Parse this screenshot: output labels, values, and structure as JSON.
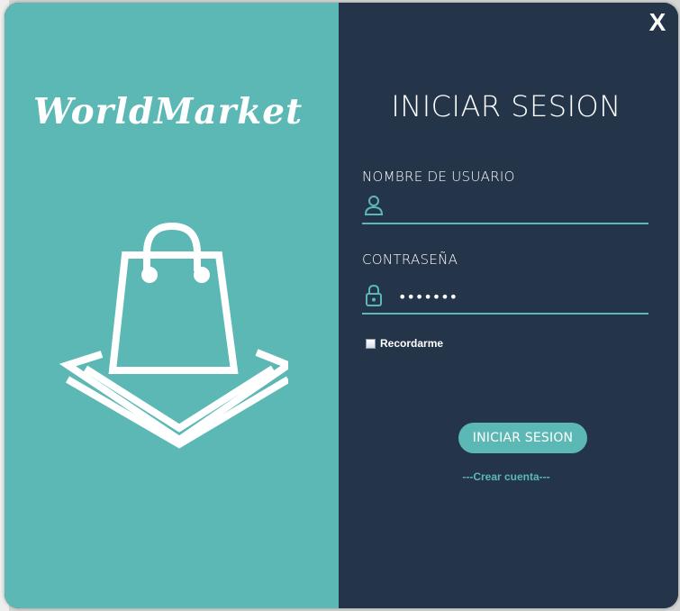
{
  "brand": {
    "name": "WorldMarket",
    "art_icon": "shopping-bag-icon"
  },
  "window": {
    "close_label": "X"
  },
  "login": {
    "title": "INICIAR SESION",
    "username_label": "NOMBRE DE USUARIO",
    "username_value": "",
    "username_icon": "user-icon",
    "password_label": "CONTRASEÑA",
    "password_value": "•••••••",
    "password_icon": "lock-icon",
    "remember_label": "Recordarme",
    "remember_checked": false,
    "submit_label": "INICIAR SESION",
    "create_account_label": "---Crear cuenta---"
  },
  "colors": {
    "accent": "#5cb8b4",
    "panel_dark": "#243549",
    "text": "#ffffff"
  }
}
